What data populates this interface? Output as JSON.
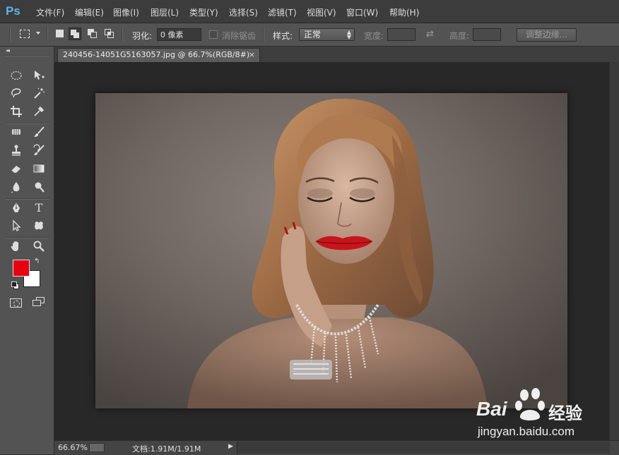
{
  "app": {
    "logo": "Ps"
  },
  "menu": [
    "文件(F)",
    "编辑(E)",
    "图像(I)",
    "图层(L)",
    "类型(Y)",
    "选择(S)",
    "滤镜(T)",
    "视图(V)",
    "窗口(W)",
    "帮助(H)"
  ],
  "options": {
    "feather_label": "羽化:",
    "feather_value": "0 像素",
    "antialias_label": "消除锯齿",
    "style_label": "样式:",
    "style_value": "正常",
    "width_label": "宽度:",
    "height_label": "高度:",
    "refine_edge_button": "调整边缘..."
  },
  "document": {
    "tab_title": "240456-14051G5163057.jpg @ 66.7%(RGB/8#)",
    "close_glyph": "×"
  },
  "status": {
    "zoom": "66.67%",
    "doc_info": "文档:1.91M/1.91M",
    "arrow": "▶"
  },
  "colors": {
    "foreground": "#e60012",
    "background": "#ffffff",
    "accent": "#5ab4f0"
  },
  "watermark": {
    "brand": "Bai",
    "brand_suffix": "经验",
    "url": "jingyan.baidu.com"
  },
  "toolbox": {
    "collapse_glyph": "◂◂",
    "type_tool_glyph": "T"
  }
}
